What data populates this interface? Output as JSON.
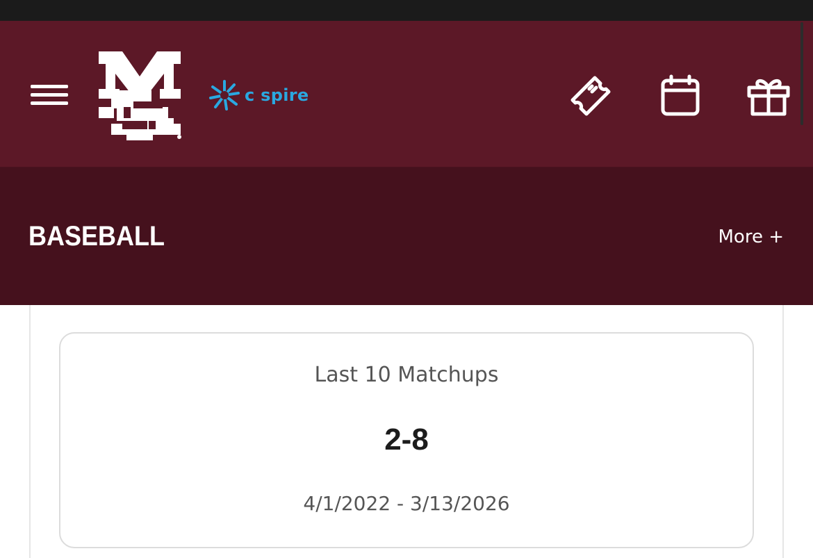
{
  "header": {
    "menu_icon": "hamburger-menu-icon",
    "logo_icon": "ms-logo-icon",
    "sponsor": {
      "icon": "cspire-burst-icon",
      "label": "c spire",
      "color": "#2aa8e0"
    },
    "actions": [
      {
        "name": "tickets",
        "icon": "ticket-icon"
      },
      {
        "name": "calendar",
        "icon": "calendar-icon"
      },
      {
        "name": "gift",
        "icon": "gift-icon"
      }
    ],
    "background": "#5c1827"
  },
  "sport_bar": {
    "title": "BASEBALL",
    "more_label": "More +",
    "background": "#45111d"
  },
  "matchup": {
    "label": "Last 10 Matchups",
    "record": "2-8",
    "date_range": "4/1/2022 - 3/13/2026"
  }
}
